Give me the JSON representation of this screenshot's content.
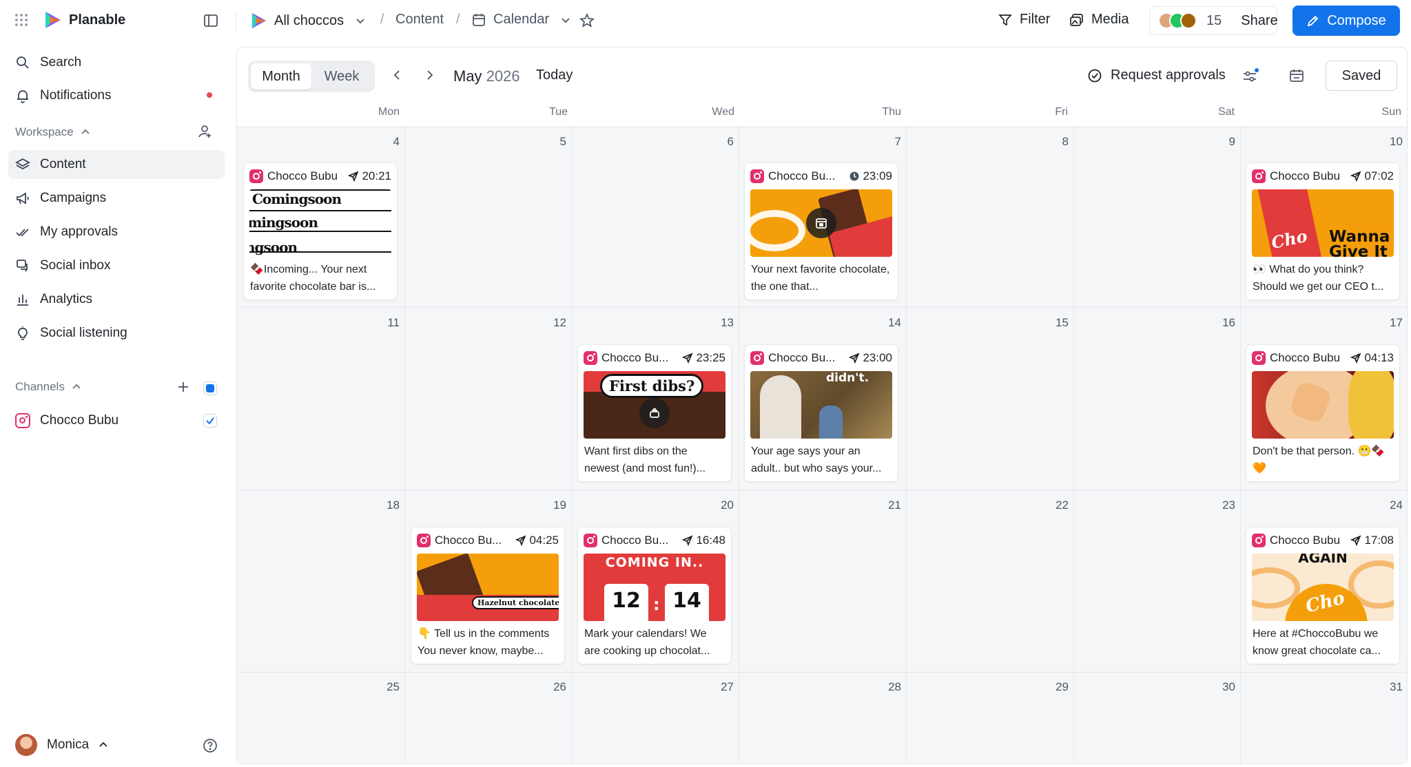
{
  "app": {
    "brand": "Planable",
    "workspace_name": "All choccos",
    "breadcrumb_content": "Content",
    "breadcrumb_view": "Calendar"
  },
  "topbar": {
    "filter": "Filter",
    "media": "Media",
    "member_count": "15",
    "share": "Share",
    "compose": "Compose",
    "avatar_colors": [
      "#e0a47a",
      "#22c55e",
      "#a16207"
    ]
  },
  "sidebar": {
    "search": "Search",
    "notifications": "Notifications",
    "workspace_label": "Workspace",
    "items": [
      {
        "label": "Content",
        "icon": "layers-icon",
        "active": true
      },
      {
        "label": "Campaigns",
        "icon": "megaphone-icon"
      },
      {
        "label": "My approvals",
        "icon": "check-double-icon"
      },
      {
        "label": "Social inbox",
        "icon": "inbox-icon"
      },
      {
        "label": "Analytics",
        "icon": "bar-chart-icon"
      },
      {
        "label": "Social listening",
        "icon": "lightbulb-icon"
      }
    ],
    "channels_label": "Channels",
    "channel": "Chocco Bubu",
    "user": "Monica"
  },
  "calendar": {
    "view_month": "Month",
    "view_week": "Week",
    "month": "May",
    "year": "2026",
    "today": "Today",
    "request_approvals": "Request approvals",
    "saved": "Saved",
    "weekdays": [
      "Mon",
      "Tue",
      "Wed",
      "Thu",
      "Fri",
      "Sat",
      "Sun"
    ],
    "weeks": [
      [
        "4",
        "5",
        "6",
        "7",
        "8",
        "9",
        "10"
      ],
      [
        "11",
        "12",
        "13",
        "14",
        "15",
        "16",
        "17"
      ],
      [
        "18",
        "19",
        "20",
        "21",
        "22",
        "23",
        "24"
      ],
      [
        "25",
        "26",
        "27",
        "28",
        "29",
        "30",
        "31"
      ]
    ],
    "posts": [
      {
        "week": 0,
        "day": 0,
        "account": "Chocco Bubu",
        "time": "20:21",
        "status": "sent",
        "caption": "🍫Incoming... Your next favorite chocolate bar is...",
        "image": "comingsoon"
      },
      {
        "week": 0,
        "day": 3,
        "account": "Chocco Bu...",
        "time": "23:09",
        "status": "scheduled",
        "caption": "Your next favorite chocolate, the one that...",
        "image": "bar-orange-badge"
      },
      {
        "week": 0,
        "day": 6,
        "account": "Chocco Bubu",
        "time": "07:02",
        "status": "sent",
        "caption": "👀 What do you think? Should we get our CEO t...",
        "image": "wanna-give"
      },
      {
        "week": 1,
        "day": 2,
        "account": "Chocco Bu...",
        "time": "23:25",
        "status": "sent",
        "caption": "Want first dibs on the newest (and most fun!)...",
        "image": "first-dibs"
      },
      {
        "week": 1,
        "day": 3,
        "account": "Chocco Bu...",
        "time": "23:00",
        "status": "sent",
        "caption": "Your age says your an adult.. but who says your...",
        "image": "park"
      },
      {
        "week": 1,
        "day": 6,
        "account": "Chocco Bubu",
        "time": "04:13",
        "status": "sent",
        "caption": "Don't be that person. 😬🍫🧡",
        "image": "cartoon"
      },
      {
        "week": 2,
        "day": 1,
        "account": "Chocco Bu...",
        "time": "04:25",
        "status": "sent",
        "caption": "👇 Tell us in the comments You never know, maybe...",
        "image": "hazelnut"
      },
      {
        "week": 2,
        "day": 2,
        "account": "Chocco Bu...",
        "time": "16:48",
        "status": "sent",
        "caption": "Mark your calendars! We are cooking up chocolat...",
        "image": "countdown"
      },
      {
        "week": 2,
        "day": 6,
        "account": "Chocco Bubu",
        "time": "17:08",
        "status": "sent",
        "caption": "Here at #ChoccoBubu we know great chocolate ca...",
        "image": "again"
      }
    ],
    "image_texts": {
      "comingsoon": "Comingsoon",
      "wanna": "Wanna Give It",
      "first_dibs": "First dibs?",
      "park": "didn't.",
      "hazelnut": "Hazelnut chocolate",
      "countdown_title": "COMING IN..",
      "countdown_days": "12",
      "countdown_hours": "14",
      "again": "AGAIN",
      "cho": "Cho"
    }
  }
}
